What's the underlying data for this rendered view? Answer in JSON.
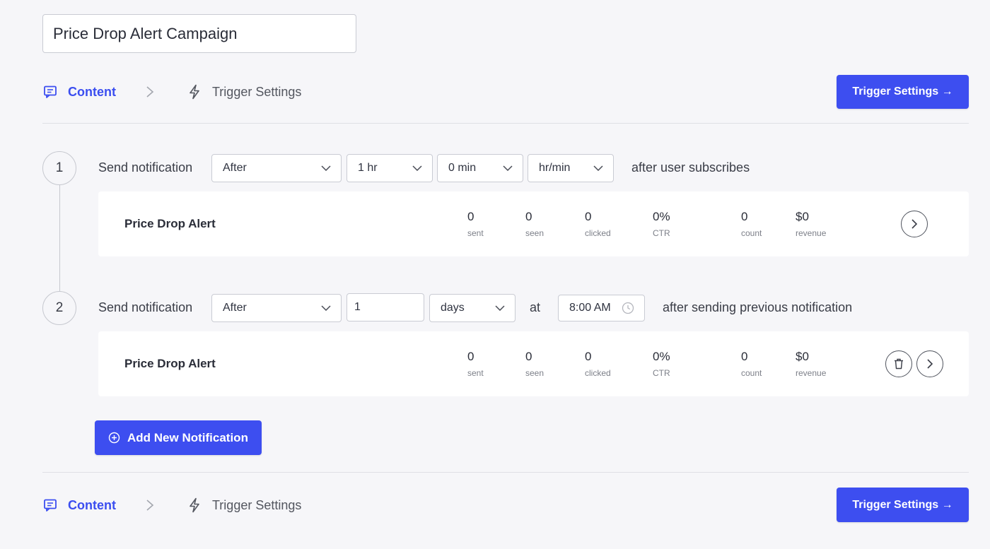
{
  "campaign": {
    "name": "Price Drop Alert Campaign"
  },
  "nav": {
    "content_label": "Content",
    "trigger_label": "Trigger Settings",
    "next_button": "Trigger Settings →"
  },
  "send_label": "Send notification",
  "stat_labels": {
    "sent": "sent",
    "seen": "seen",
    "clicked": "clicked",
    "ctr": "CTR",
    "count": "count",
    "revenue": "revenue"
  },
  "steps": [
    {
      "number": "1",
      "timing": "After",
      "hours": "1 hr",
      "minutes": "0 min",
      "unit": "hr/min",
      "suffix": "after user subscribes",
      "card": {
        "name": "Price Drop Alert",
        "sent": "0",
        "seen": "0",
        "clicked": "0",
        "ctr": "0%",
        "count": "0",
        "revenue": "$0"
      }
    },
    {
      "number": "2",
      "timing": "After",
      "amount": "1",
      "unit": "days",
      "at_label": "at",
      "time": "8:00 AM",
      "suffix": "after sending previous notification",
      "card": {
        "name": "Price Drop Alert",
        "sent": "0",
        "seen": "0",
        "clicked": "0",
        "ctr": "0%",
        "count": "0",
        "revenue": "$0"
      }
    }
  ],
  "add_button": "Add New Notification",
  "colors": {
    "accent": "#3d4ef0",
    "background": "#f6f6f9",
    "card": "#ffffff",
    "border": "#c9cbd3"
  },
  "icons": [
    "message-square-icon",
    "chevron-right-icon",
    "lightning-icon",
    "chevron-down-icon",
    "clock-icon",
    "trash-icon",
    "circle-chevron-right-icon",
    "plus-circle-icon"
  ]
}
